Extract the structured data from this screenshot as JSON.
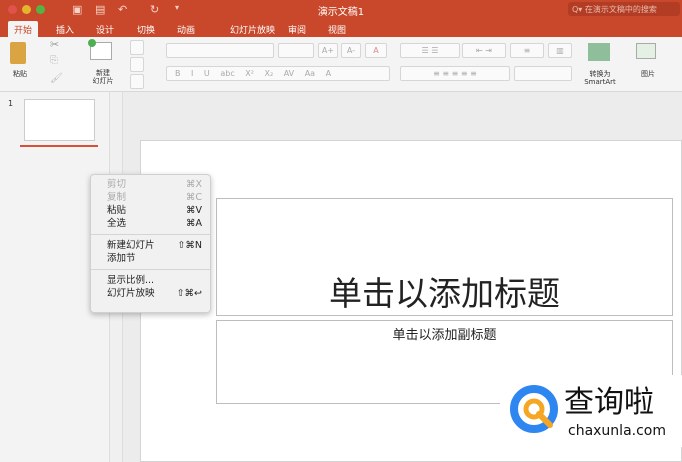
{
  "window": {
    "title": "演示文稿1",
    "search_placeholder": "在演示文稿中的搜索"
  },
  "tabs": [
    "开始",
    "插入",
    "设计",
    "切换",
    "动画",
    "幻灯片放映",
    "审阅",
    "视图"
  ],
  "ribbon": {
    "paste": "粘贴",
    "new_slide": "新建\n幻灯片",
    "smartart": "转换为\nSmartArt",
    "picture": "图片"
  },
  "slide_pane": {
    "number": "1"
  },
  "slide": {
    "title_placeholder": "单击以添加标题",
    "subtitle_placeholder": "单击以添加副标题"
  },
  "context_menu": [
    {
      "label": "剪切",
      "shortcut": "⌘X",
      "disabled": true
    },
    {
      "label": "复制",
      "shortcut": "⌘C",
      "disabled": true
    },
    {
      "label": "粘贴",
      "shortcut": "⌘V"
    },
    {
      "label": "全选",
      "shortcut": "⌘A"
    },
    {
      "label": "新建幻灯片",
      "shortcut": "⇧⌘N"
    },
    {
      "label": "添加节",
      "shortcut": ""
    },
    {
      "label": "显示比例...",
      "shortcut": ""
    },
    {
      "label": "幻灯片放映",
      "shortcut": "⇧⌘↩"
    }
  ],
  "watermark": {
    "name": "查询啦",
    "domain": "chaxunla.com"
  },
  "colors": {
    "accent": "#c9482b"
  }
}
